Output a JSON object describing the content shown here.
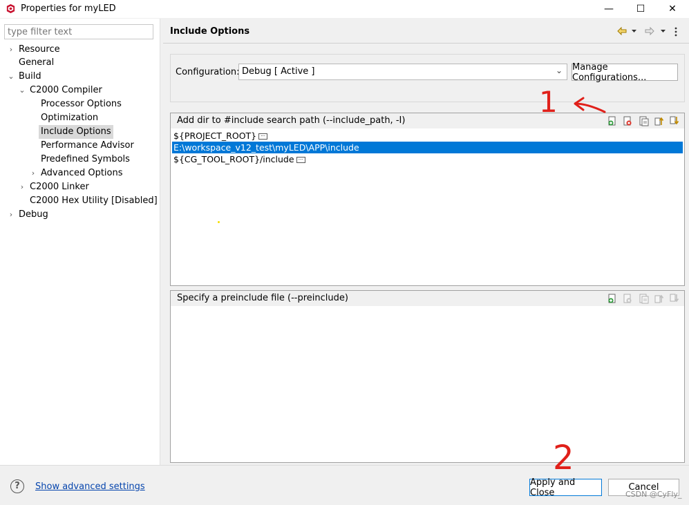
{
  "window": {
    "title": "Properties for myLED",
    "minimize": "—",
    "maximize": "☐",
    "close": "✕"
  },
  "sidebar": {
    "filter_placeholder": "type filter text",
    "items": [
      {
        "label": "Resource"
      },
      {
        "label": "General"
      },
      {
        "label": "Build"
      },
      {
        "label": "C2000 Compiler"
      },
      {
        "label": "Processor Options"
      },
      {
        "label": "Optimization"
      },
      {
        "label": "Include Options"
      },
      {
        "label": "Performance Advisor"
      },
      {
        "label": "Predefined Symbols"
      },
      {
        "label": "Advanced Options"
      },
      {
        "label": "C2000 Linker"
      },
      {
        "label": "C2000 Hex Utility  [Disabled]"
      },
      {
        "label": "Debug"
      }
    ]
  },
  "header": {
    "title": "Include Options"
  },
  "configuration": {
    "label": "Configuration:",
    "value": "Debug  [ Active ]",
    "manage_button": "Manage Configurations..."
  },
  "include_panel": {
    "title": "Add dir to #include search path (--include_path, -I)",
    "rows": [
      {
        "text": "${PROJECT_ROOT}"
      },
      {
        "text": "E:\\workspace_v12_test\\myLED\\APP\\include"
      },
      {
        "text": "${CG_TOOL_ROOT}/include"
      }
    ]
  },
  "preinclude_panel": {
    "title": "Specify a preinclude file (--preinclude)"
  },
  "footer": {
    "advanced_link": "Show advanced settings",
    "apply_close": "Apply and Close",
    "cancel": "Cancel",
    "watermark": "CSDN @CyFly_"
  },
  "annotations": {
    "mark_1": "1",
    "mark_2": "2"
  },
  "colors": {
    "selection": "#0078d7",
    "annotation": "#e0201a",
    "link": "#0645ad"
  }
}
